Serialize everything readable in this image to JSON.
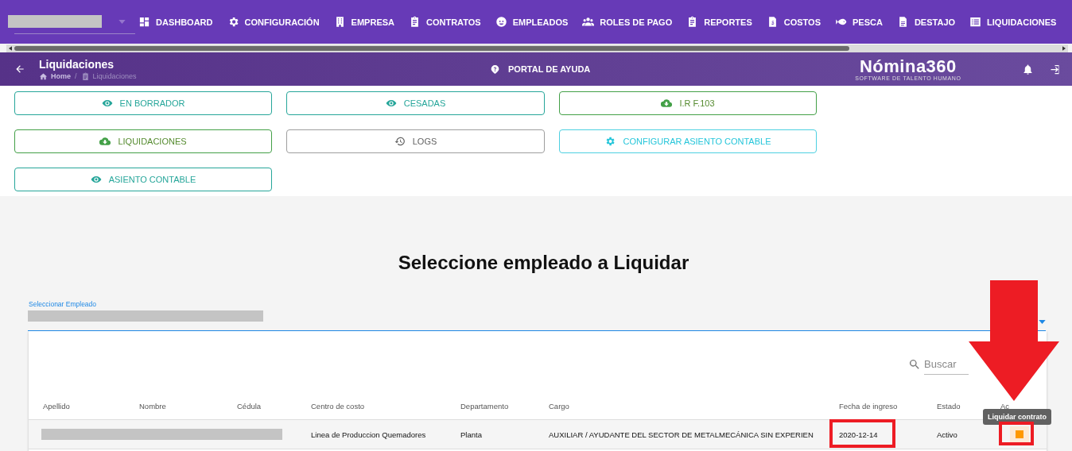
{
  "top_nav": {
    "items": [
      {
        "label": "DASHBOARD",
        "kind": "dashboard"
      },
      {
        "label": "CONFIGURACIÓN",
        "kind": "settings"
      },
      {
        "label": "EMPRESA",
        "kind": "building"
      },
      {
        "label": "CONTRATOS",
        "kind": "clipboard"
      },
      {
        "label": "EMPLEADOS",
        "kind": "face"
      },
      {
        "label": "ROLES DE PAGO",
        "kind": "people"
      },
      {
        "label": "REPORTES",
        "kind": "clipboard"
      },
      {
        "label": "COSTOS",
        "kind": "invoice"
      },
      {
        "label": "PESCA",
        "kind": "fish"
      },
      {
        "label": "DESTAJO",
        "kind": "document"
      },
      {
        "label": "LIQUIDACIONES",
        "kind": "list"
      }
    ]
  },
  "header": {
    "title": "Liquidaciones",
    "breadcrumb": [
      {
        "label": "Home",
        "kind": "home"
      },
      {
        "label": "Liquidaciones",
        "kind": "page"
      }
    ],
    "breadcrumb_separator": "/",
    "help_link": "PORTAL DE AYUDA",
    "logo": {
      "name": "Nómina360",
      "tagline": "SOFTWARE DE TALENTO HUMANO"
    }
  },
  "actions": [
    {
      "label": "EN BORRADOR",
      "kind": "view"
    },
    {
      "label": "CESADAS",
      "kind": "view"
    },
    {
      "label": "I.R F.103",
      "kind": "download"
    },
    {
      "label": "LIQUIDACIONES",
      "kind": "download"
    },
    {
      "label": "LOGS",
      "kind": "logs"
    },
    {
      "label": "CONFIGURAR ASIENTO CONTABLE",
      "kind": "settings"
    },
    {
      "label": "ASIENTO CONTABLE",
      "kind": "view"
    }
  ],
  "section_title": "Seleccione empleado a Liquidar",
  "employee_select": {
    "label": "Seleccionar Empleado"
  },
  "table": {
    "search": {
      "placeholder": "Buscar"
    },
    "columns": [
      "Apellido",
      "Nombre",
      "Cédula",
      "Centro de costo",
      "Departamento",
      "Cargo",
      "Fecha de ingreso",
      "Estado",
      "Ac"
    ],
    "rows": [
      {
        "centro_de_costo": "Linea de Produccion Quemadores",
        "departamento": "Planta",
        "cargo": "AUXILIAR / AYUDANTE DEL SECTOR DE METALMECÁNICA SIN EXPERIEN",
        "fecha_de_ingreso": "2020-12-14",
        "estado": "Activo"
      }
    ]
  },
  "tooltip": "Liquidar contrato"
}
